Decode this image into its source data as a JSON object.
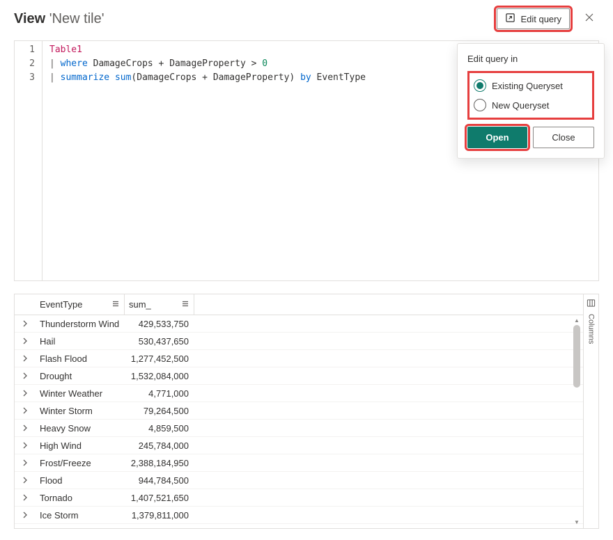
{
  "header": {
    "title_prefix": "View",
    "title_name": "'New tile'",
    "edit_query_label": "Edit query"
  },
  "code": {
    "line1": {
      "table": "Table1"
    },
    "line2": {
      "pipe": "|",
      "kw": "where",
      "id1": "DamageCrops",
      "op1": "+",
      "id2": "DamageProperty",
      "op2": ">",
      "num": "0"
    },
    "line3": {
      "pipe": "|",
      "kw1": "summarize",
      "fn": "sum",
      "lp": "(",
      "id1": "DamageCrops",
      "op": "+",
      "id2": "DamageProperty",
      "rp": ")",
      "kw2": "by",
      "id3": "EventType"
    },
    "gutter": [
      "1",
      "2",
      "3"
    ]
  },
  "table": {
    "columns": {
      "event": "EventType",
      "sum": "sum_"
    },
    "rows": [
      {
        "event": "Thunderstorm Wind",
        "sum": "429,533,750"
      },
      {
        "event": "Hail",
        "sum": "530,437,650"
      },
      {
        "event": "Flash Flood",
        "sum": "1,277,452,500"
      },
      {
        "event": "Drought",
        "sum": "1,532,084,000"
      },
      {
        "event": "Winter Weather",
        "sum": "4,771,000"
      },
      {
        "event": "Winter Storm",
        "sum": "79,264,500"
      },
      {
        "event": "Heavy Snow",
        "sum": "4,859,500"
      },
      {
        "event": "High Wind",
        "sum": "245,784,000"
      },
      {
        "event": "Frost/Freeze",
        "sum": "2,388,184,950"
      },
      {
        "event": "Flood",
        "sum": "944,784,500"
      },
      {
        "event": "Tornado",
        "sum": "1,407,521,650"
      },
      {
        "event": "Ice Storm",
        "sum": "1,379,811,000"
      }
    ],
    "columns_tab": "Columns"
  },
  "popup": {
    "title": "Edit query in",
    "option1": "Existing Queryset",
    "option2": "New Queryset",
    "open": "Open",
    "close": "Close"
  }
}
